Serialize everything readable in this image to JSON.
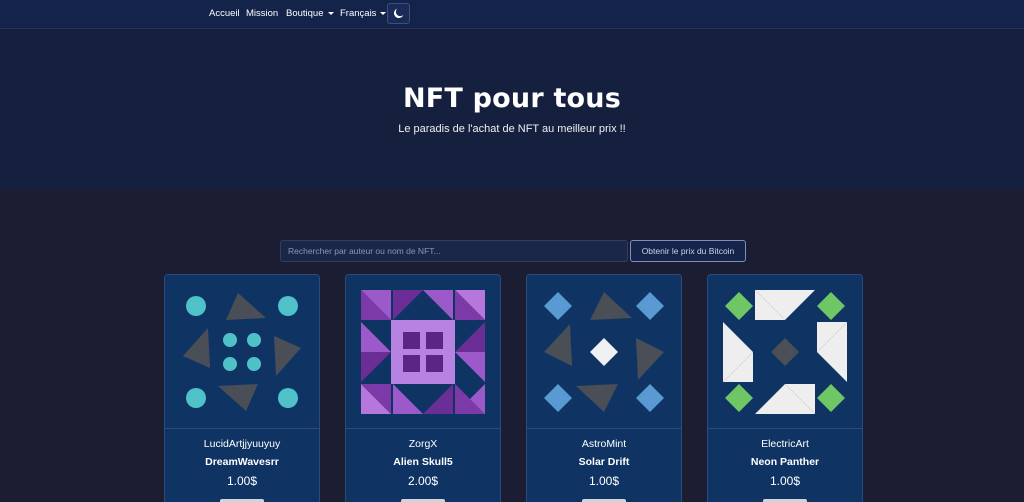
{
  "colors": {
    "background": "#1b1d33",
    "navbar": "#13234a",
    "hero": "#15203f",
    "card": "#0f3464"
  },
  "nav": {
    "items": [
      {
        "label": "Accueil"
      },
      {
        "label": "Mission"
      },
      {
        "label": "Boutique",
        "dropdown": true
      },
      {
        "label": "Français",
        "dropdown": true
      }
    ],
    "theme_toggle_icon": "moon-icon"
  },
  "hero": {
    "title": "NFT pour tous",
    "subtitle": "Le paradis de l'achat de NFT au meilleur prix !!"
  },
  "search": {
    "placeholder": "Rechercher par auteur ou nom de NFT...",
    "value": "",
    "bitcoin_button": "Obtenir le prix du Bitcoin"
  },
  "cards": [
    {
      "author": "LucidArtjjyuuyuy",
      "name": "DreamWavesrr",
      "price": "1.00$",
      "art": "identicon-cyan-circles"
    },
    {
      "author": "ZorgX",
      "name": "Alien Skull5",
      "price": "2.00$",
      "art": "identicon-purple-grid"
    },
    {
      "author": "AstroMint",
      "name": "Solar Drift",
      "price": "1.00$",
      "art": "identicon-blue-diamonds"
    },
    {
      "author": "ElectricArt",
      "name": "Neon Panther",
      "price": "1.00$",
      "art": "identicon-green-white-triangles"
    }
  ]
}
